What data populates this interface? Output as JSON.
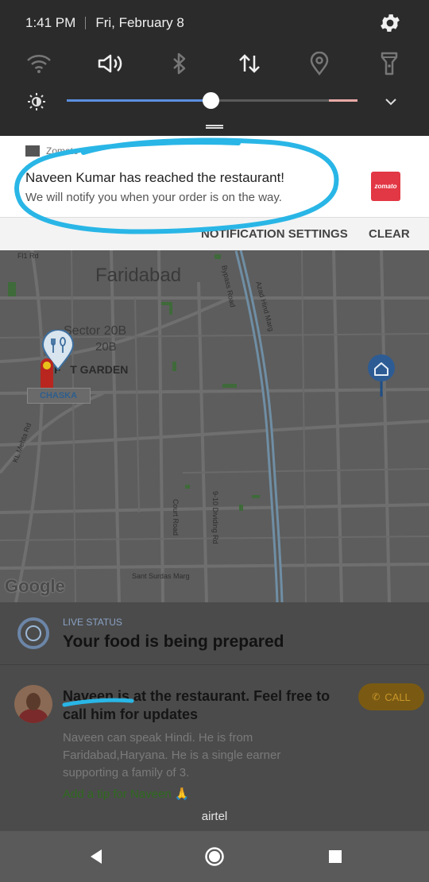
{
  "status_bar": {
    "time": "1:41 PM",
    "date": "Fri, February 8"
  },
  "quick_settings": {
    "tiles": [
      "wifi-icon",
      "volume-icon",
      "bluetooth-icon",
      "data-transfer-icon",
      "location-icon",
      "flashlight-icon"
    ],
    "brightness_level": 0.5
  },
  "notification": {
    "app_name": "Zomato",
    "title": "Naveen Kumar has reached the restaurant!",
    "text": "We will notify you when your order is on the way.",
    "logo_text": "zomato",
    "actions": {
      "settings": "NOTIFICATION SETTINGS",
      "clear": "CLEAR"
    }
  },
  "map": {
    "city_label": "Faridabad",
    "sector_label": "Sector 20B",
    "sector_sub": "20B",
    "garden_label": "F   T GARDEN",
    "restaurant_tag": "CHASKA",
    "roads": {
      "r1": "Bypass Road",
      "r2": "Azad Hind Marg",
      "r3": "KL Mehta Rd",
      "r4": "Court Road",
      "r5": "9-10 Dividing Rd",
      "r6": "Sant Surdas Marg",
      "r7": "Fl1 Rd"
    },
    "attribution": "Google"
  },
  "order": {
    "live_label": "LIVE STATUS",
    "live_title": "Your food is being prepared",
    "driver_message": "Naveen is at the restaurant. Feel free to call him for updates",
    "call_label": "CALL",
    "driver_info": "Naveen can speak Hindi. He is from Faridabad,Haryana. He is a single earner supporting a family of 3.",
    "tip_label": "Add a tip for Naveen 🙏"
  },
  "carrier": "airtel",
  "colors": {
    "accent_blue": "#5b8ee0",
    "scribble": "#29b6e6",
    "zomato_red": "#e23744"
  }
}
